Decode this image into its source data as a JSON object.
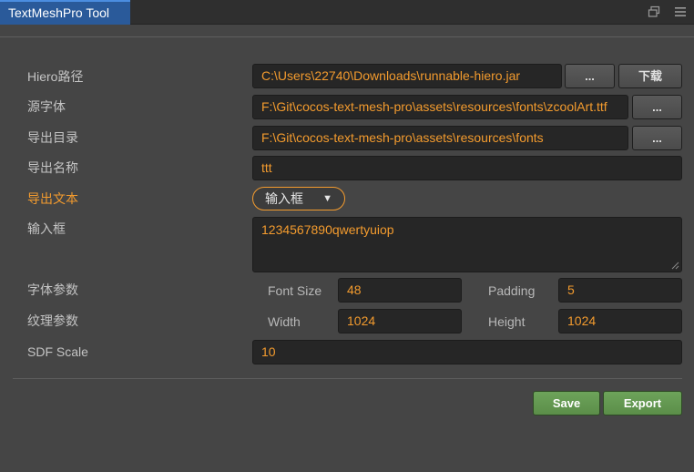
{
  "tab": {
    "title": "TextMeshPro Tool"
  },
  "rows": {
    "hiero": {
      "label": "Hiero路径",
      "value": "C:\\Users\\22740\\Downloads\\runnable-hiero.jar",
      "browse": "...",
      "download": "下载"
    },
    "source_font": {
      "label": "源字体",
      "value": "F:\\Git\\cocos-text-mesh-pro\\assets\\resources\\fonts\\zcoolArt.ttf",
      "browse": "..."
    },
    "export_dir": {
      "label": "导出目录",
      "value": "F:\\Git\\cocos-text-mesh-pro\\assets\\resources\\fonts",
      "browse": "..."
    },
    "export_name": {
      "label": "导出名称",
      "value": "ttt"
    },
    "export_text": {
      "label": "导出文本",
      "selected": "输入框"
    },
    "input_box": {
      "label": "输入框",
      "value": "1234567890qwertyuiop"
    },
    "font_params": {
      "label": "字体参数",
      "font_size_label": "Font Size",
      "font_size": "48",
      "padding_label": "Padding",
      "padding": "5"
    },
    "texture_params": {
      "label": "纹理参数",
      "width_label": "Width",
      "width": "1024",
      "height_label": "Height",
      "height": "1024"
    },
    "sdf_scale": {
      "label": "SDF Scale",
      "value": "10"
    }
  },
  "actions": {
    "save": "Save",
    "export": "Export"
  },
  "colors": {
    "accent": "#f39b2e",
    "tab_active": "#2a5a9a",
    "button_green": "#6da35a"
  }
}
